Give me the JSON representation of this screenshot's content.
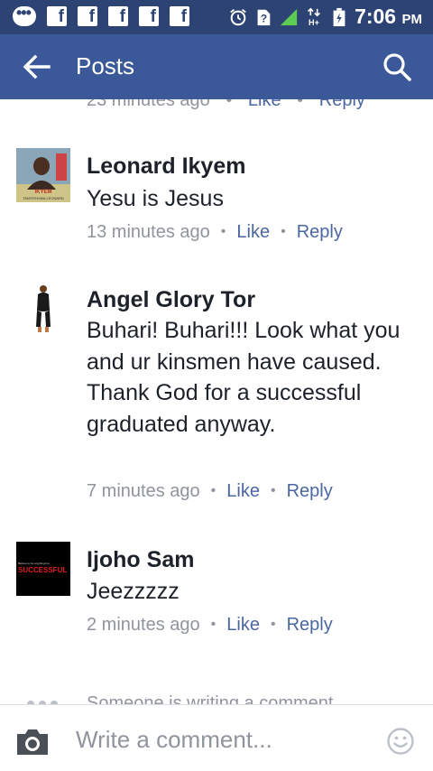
{
  "status_bar": {
    "icons": [
      "chat-icon",
      "facebook-icon",
      "facebook-icon",
      "facebook-icon",
      "facebook-icon",
      "facebook-icon"
    ],
    "facebook_glyph": "f",
    "right_icons": [
      "alarm-clock-icon",
      "unknown-sim-icon",
      "signal-icon",
      "h-plus-data-icon",
      "battery-icon"
    ],
    "time": "7:06",
    "ampm": "PM"
  },
  "app_bar": {
    "title": "Posts",
    "color": "#3b5998"
  },
  "partial_comment": {
    "time": "23 minutes ago",
    "like": "Like",
    "reply": "Reply"
  },
  "comments": [
    {
      "name": "Leonard Ikyem",
      "text": "Yesu is Jesus",
      "time": "13 minutes ago",
      "like": "Like",
      "reply": "Reply",
      "avatar_caption_top": "IKYEM",
      "avatar_caption_bottom": "TAVERSHIMA LEONARD"
    },
    {
      "name": "Angel Glory Tor",
      "text": "Buhari! Buhari!!!  Look what you and ur kinsmen have caused. Thank  God for a successful graduated anyway.",
      "time": "7 minutes ago",
      "like": "Like",
      "reply": "Reply"
    },
    {
      "name": "Ijoho Sam",
      "text": "Jeezzzzz",
      "time": "2 minutes ago",
      "like": "Like",
      "reply": "Reply",
      "avatar_caption_top": "Believe to be anything but",
      "avatar_caption_main": "SUCCESSFUL"
    }
  ],
  "typing_indicator": "Someone is writing a comment...",
  "composer": {
    "placeholder": "Write a comment..."
  },
  "colors": {
    "status_bar": "#2c4374",
    "link": "#4b67a1",
    "meta": "#90949c",
    "text": "#1d2129"
  }
}
